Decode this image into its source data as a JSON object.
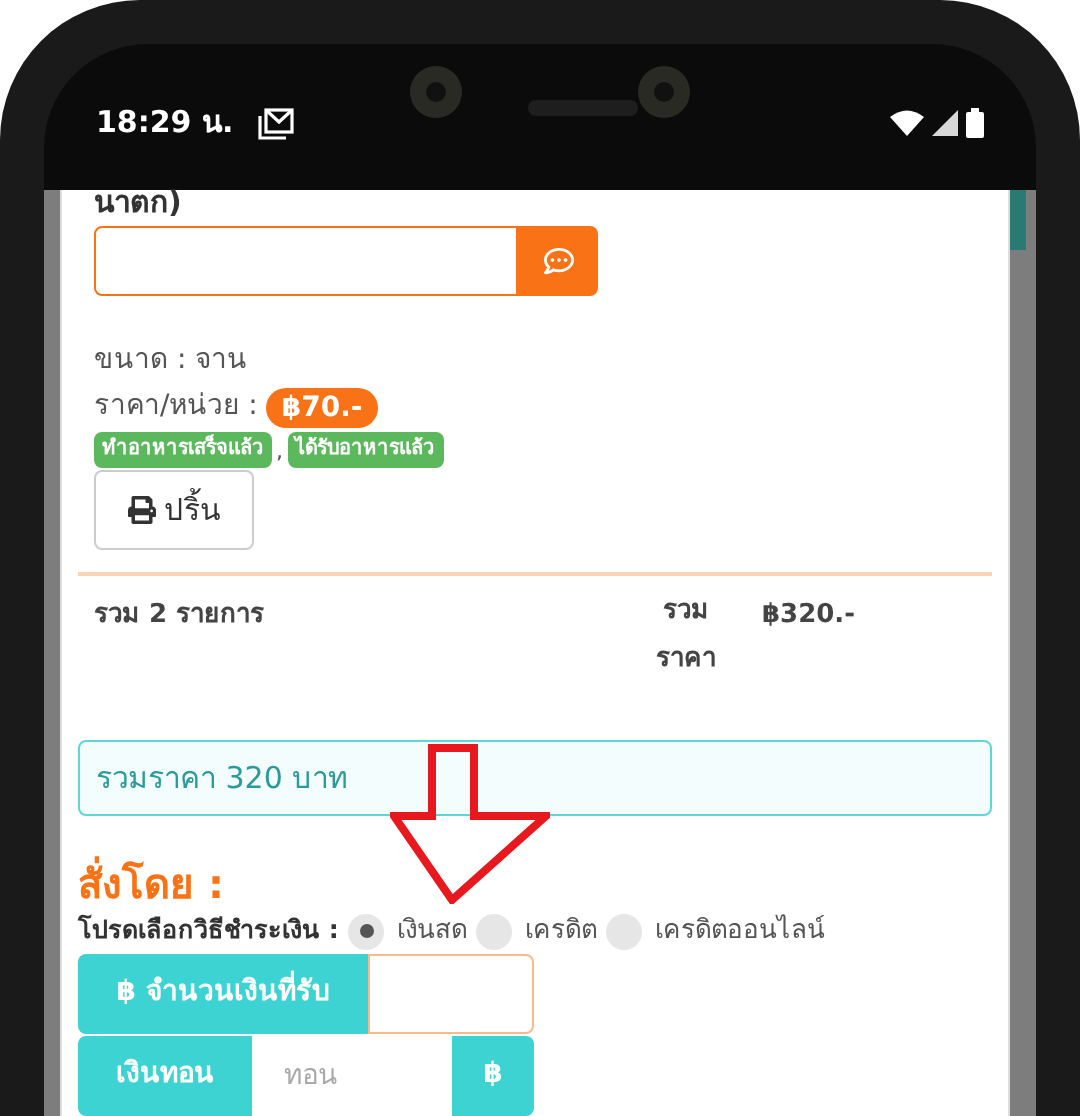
{
  "status_bar": {
    "time": "18:29 น."
  },
  "order_item": {
    "title_tail": "นาตก)",
    "size": "ขนาด : จาน",
    "price_label": "ราคา/หน่วย :",
    "price": "฿70.-",
    "statuses": [
      "ทำอาหารเสร็จแล้ว",
      "ได้รับอาหารแล้ว"
    ],
    "separator": ",",
    "print_button": "ปริ้น"
  },
  "summary": {
    "count": "รวม 2 รายการ",
    "total_label": "รวม ราคา",
    "total": "฿320.-"
  },
  "total_alert": "รวมราคา 320 บาท",
  "order_by": {
    "heading": "สั่งโดย :",
    "payment_label": "โปรดเลือกวิธีชำระเงิน :",
    "payment_options": [
      {
        "label": "เงินสด",
        "selected": true
      },
      {
        "label": "เครดิต",
        "selected": false
      },
      {
        "label": "เครดิตออนไลน์",
        "selected": false
      }
    ],
    "received_label": "฿ จำนวนเงินที่รับ",
    "change": {
      "label": "เงินทอน",
      "placeholder": "ทอน",
      "suffix": "฿"
    }
  }
}
